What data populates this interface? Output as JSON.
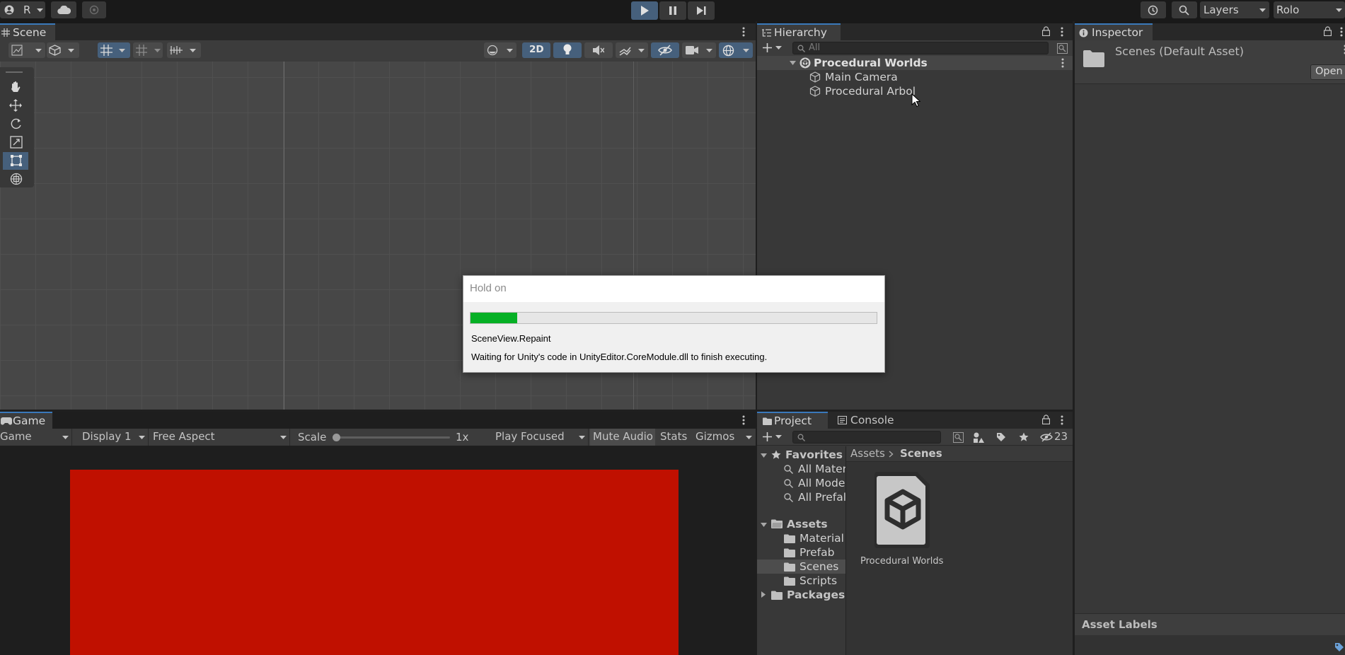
{
  "toolbar": {
    "account_label": "R",
    "layers_label": "Layers",
    "layout_label": "Rolo"
  },
  "scene_panel": {
    "tab_label": "Scene",
    "mode_2d_label": "2D"
  },
  "hierarchy_panel": {
    "tab_label": "Hierarchy",
    "search_placeholder": "All",
    "items": [
      {
        "label": "Procedural Worlds"
      },
      {
        "label": "Main Camera"
      },
      {
        "label": "Procedural Arbol"
      }
    ]
  },
  "inspector_panel": {
    "tab_label": "Inspector",
    "asset_title": "Scenes (Default Asset)",
    "open_label": "Open",
    "asset_labels_title": "Asset Labels"
  },
  "game_panel": {
    "tab_label": "Game",
    "view_select": "Game",
    "display_select": "Display 1",
    "aspect_select": "Free Aspect",
    "scale_label": "Scale",
    "scale_value": "1x",
    "play_focused_select": "Play Focused",
    "mute_audio_label": "Mute Audio",
    "stats_label": "Stats",
    "gizmos_label": "Gizmos",
    "background_color": "#c01000"
  },
  "project_panel": {
    "tab_project": "Project",
    "tab_console": "Console",
    "hidden_count": "23",
    "favorites_label": "Favorites",
    "favorites": [
      "All Mater",
      "All Mode",
      "All Prefal"
    ],
    "assets_label": "Assets",
    "asset_folders": [
      "Material",
      "Prefab",
      "Scenes",
      "Scripts"
    ],
    "packages_label": "Packages",
    "breadcrumb_root": "Assets",
    "breadcrumb_current": "Scenes",
    "grid_items": [
      {
        "label": "Procedural Worlds"
      }
    ]
  },
  "dialog": {
    "title": "Hold on",
    "progress_fraction": 0.115,
    "progress_color": "#06b025",
    "operation": "SceneView.Repaint",
    "message": "Waiting for Unity's code in UnityEditor.CoreModule.dll to finish executing."
  }
}
